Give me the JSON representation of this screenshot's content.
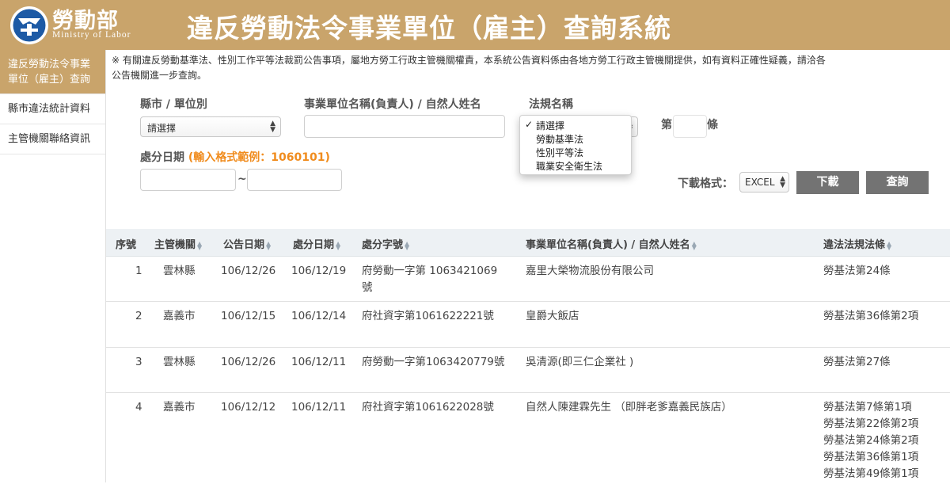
{
  "header": {
    "logo_cn": "勞動部",
    "logo_en": "Ministry of Labor",
    "title": "違反勞動法令事業單位（雇主）查詢系統"
  },
  "sidebar": {
    "items": [
      {
        "label_line1": "違反勞動法令事業",
        "label_line2": "單位（雇主）查詢"
      },
      {
        "label": "縣市違法統計資料"
      },
      {
        "label": "主管機關聯絡資訊"
      }
    ]
  },
  "notice": {
    "line1": "※ 有關違反勞動基準法、性別工作平等法裁罰公告事項，屬地方勞工行政主管機關權責，本系統公告資料係由各地方勞工行政主管機關提供，如有資料正確性疑義，請洽各",
    "line2": "公告機關進一步查詢。"
  },
  "form": {
    "county_label": "縣市 / 單位別",
    "county_value": "請選擇",
    "company_label": "事業單位名稱(負責人) / 自然人姓名",
    "company_value": "",
    "law_label": "法規名稱",
    "law_options": [
      "請選擇",
      "勞動基準法",
      "性別平等法",
      "職業安全衛生法"
    ],
    "law_selected": "請選擇",
    "article_prefix": "第",
    "article_suffix": "條",
    "article_value": "",
    "date_label": "處分日期",
    "date_hint": "(輸入格式範例：1060101)",
    "date_sep": "~",
    "date_from": "",
    "date_to": "",
    "download_format_label": "下載格式：",
    "download_format_value": "EXCEL",
    "download_button": "下載",
    "search_button": "查詢"
  },
  "table": {
    "columns": [
      "序號",
      "主管機關",
      "公告日期",
      "處分日期",
      "處分字號",
      "事業單位名稱(負責人) / 自然人姓名",
      "違法法規法條"
    ],
    "rows": [
      {
        "no": "1",
        "agency": "雲林縣",
        "announce": "106/12/26",
        "penalty": "106/12/19",
        "doc_line1": "府勞動一字第 1063421069",
        "doc_line2": "號",
        "company": "嘉里大榮物流股份有限公司",
        "laws": [
          "勞基法第24條"
        ]
      },
      {
        "no": "2",
        "agency": "嘉義市",
        "announce": "106/12/15",
        "penalty": "106/12/14",
        "doc_line1": "府社資字第1061622221號",
        "doc_line2": "",
        "company": "皇爵大飯店",
        "laws": [
          "勞基法第36條第2項"
        ]
      },
      {
        "no": "3",
        "agency": "雲林縣",
        "announce": "106/12/26",
        "penalty": "106/12/11",
        "doc_line1": "府勞動一字第1063420779號",
        "doc_line2": "",
        "company": "吳清源(即三仁企業社 )",
        "laws": [
          "勞基法第27條"
        ]
      },
      {
        "no": "4",
        "agency": "嘉義市",
        "announce": "106/12/12",
        "penalty": "106/12/11",
        "doc_line1": "府社資字第1061622028號",
        "doc_line2": "",
        "company": "自然人陳建霖先生 （即胖老爹嘉義民族店）",
        "laws": [
          "勞基法第7條第1項",
          "勞基法第22條第2項",
          "勞基法第24條第2項",
          "勞基法第36條第1項",
          "勞基法第49條第1項"
        ]
      }
    ]
  },
  "colors": {
    "header_bg": "#c9a46b",
    "logo_blue": "#1d5aa5",
    "hint_orange": "#f08c1e",
    "button_gray": "#737373",
    "table_head_bg": "#edf1f4"
  }
}
